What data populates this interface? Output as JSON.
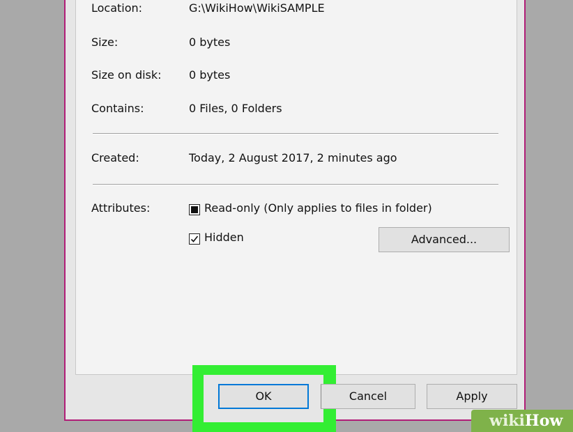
{
  "properties": {
    "location_label": "Location:",
    "location_value": "G:\\WikiHow\\WikiSAMPLE",
    "size_label": "Size:",
    "size_value": "0 bytes",
    "size_on_disk_label": "Size on disk:",
    "size_on_disk_value": "0 bytes",
    "contains_label": "Contains:",
    "contains_value": "0 Files, 0 Folders",
    "created_label": "Created:",
    "created_value": "Today, 2 August 2017, 2 minutes ago",
    "attributes_label": "Attributes:"
  },
  "attributes": {
    "read_only": {
      "label": "Read-only (Only applies to files in folder)",
      "state": "indeterminate"
    },
    "hidden": {
      "label": "Hidden",
      "state": "checked"
    },
    "advanced_label": "Advanced..."
  },
  "footer": {
    "ok_label": "OK",
    "cancel_label": "Cancel",
    "apply_label": "Apply"
  },
  "highlight_color": "#33ee33",
  "watermark": "wikiHow"
}
